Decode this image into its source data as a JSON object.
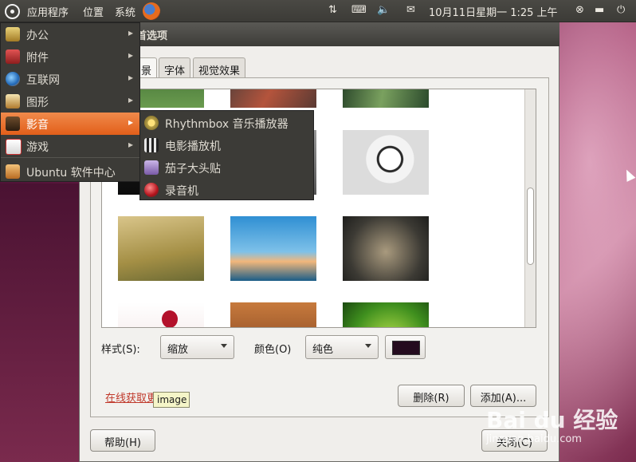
{
  "panel": {
    "menu_apps": "应用程序",
    "menu_places": "位置",
    "menu_system": "系统",
    "clock": "10月11日星期一  1:25 上午"
  },
  "dialog": {
    "title": "首选项",
    "tabs": [
      "景",
      "字体",
      "视觉效果"
    ],
    "style_label": "样式(S):",
    "style_value": "缩放",
    "color_label": "颜色(O)",
    "color_value": "纯色",
    "color_swatch": "#240b1e",
    "online_link": "在线获取更多背景",
    "remove_button": "删除(R)",
    "add_button": "添加(A)...",
    "help_button": "帮助(H)",
    "close_button": "关闭(C)"
  },
  "menu": {
    "items": [
      {
        "label": "办公",
        "icon": "office-icon"
      },
      {
        "label": "附件",
        "icon": "accessories-icon"
      },
      {
        "label": "互联网",
        "icon": "internet-icon"
      },
      {
        "label": "图形",
        "icon": "graphics-icon"
      },
      {
        "label": "影音",
        "icon": "multimedia-icon"
      },
      {
        "label": "游戏",
        "icon": "games-icon"
      },
      {
        "label": "Ubuntu 软件中心",
        "icon": "software-center-icon"
      }
    ],
    "submenu": [
      {
        "label": "Rhythmbox 音乐播放器",
        "icon": "rhythmbox-icon"
      },
      {
        "label": "电影播放机",
        "icon": "movie-player-icon"
      },
      {
        "label": "茄子大头贴",
        "icon": "cheese-icon"
      },
      {
        "label": "录音机",
        "icon": "sound-recorder-icon"
      }
    ]
  },
  "tooltip": "image",
  "watermark": {
    "brand": "Bai du 经验",
    "url": "jingyan.baidu.com"
  }
}
